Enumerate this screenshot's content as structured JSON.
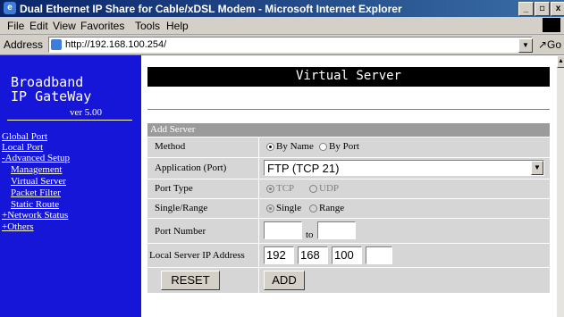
{
  "window": {
    "title": "Dual Ethernet IP Share for Cable/xDSL Modem - Microsoft Internet Explorer",
    "min": "_",
    "max": "8",
    "close": "x"
  },
  "menu": [
    "File",
    "Edit",
    "View",
    "Favorites",
    "Tools",
    "Help"
  ],
  "address": {
    "label": "Address",
    "url": "http://192.168.100.254/",
    "go": "↗Go"
  },
  "sidebar": {
    "brand_line1": "Broadband",
    "brand_line2": "IP GateWay",
    "version": "ver 5.00",
    "items": [
      {
        "label": "Global Port"
      },
      {
        "label": "Local Port"
      },
      {
        "label": "-Advanced Setup"
      },
      {
        "label": "Management"
      },
      {
        "label": "Virtual Server"
      },
      {
        "label": "Packet Filter"
      },
      {
        "label": "Static Route"
      },
      {
        "label": "+Network Status"
      },
      {
        "label": "+Others"
      }
    ]
  },
  "page": {
    "title": "Virtual Server",
    "section": "Add Server"
  },
  "form": {
    "method": {
      "label": "Method",
      "opt1": "By Name",
      "opt2": "By Port"
    },
    "application": {
      "label": "Application (Port)",
      "value": "FTP (TCP 21)"
    },
    "port_type": {
      "label": "Port Type",
      "opt1": "TCP",
      "opt2": "UDP"
    },
    "range": {
      "label": "Single/Range",
      "opt1": "Single",
      "opt2": "Range"
    },
    "port_number": {
      "label": "Port Number",
      "to": "to",
      "from_value": "",
      "to_value": ""
    },
    "local_ip": {
      "label": "Local Server IP Address",
      "o1": "192",
      "o2": "168",
      "o3": "100",
      "o4": ""
    },
    "reset": "RESET",
    "add": "ADD"
  }
}
